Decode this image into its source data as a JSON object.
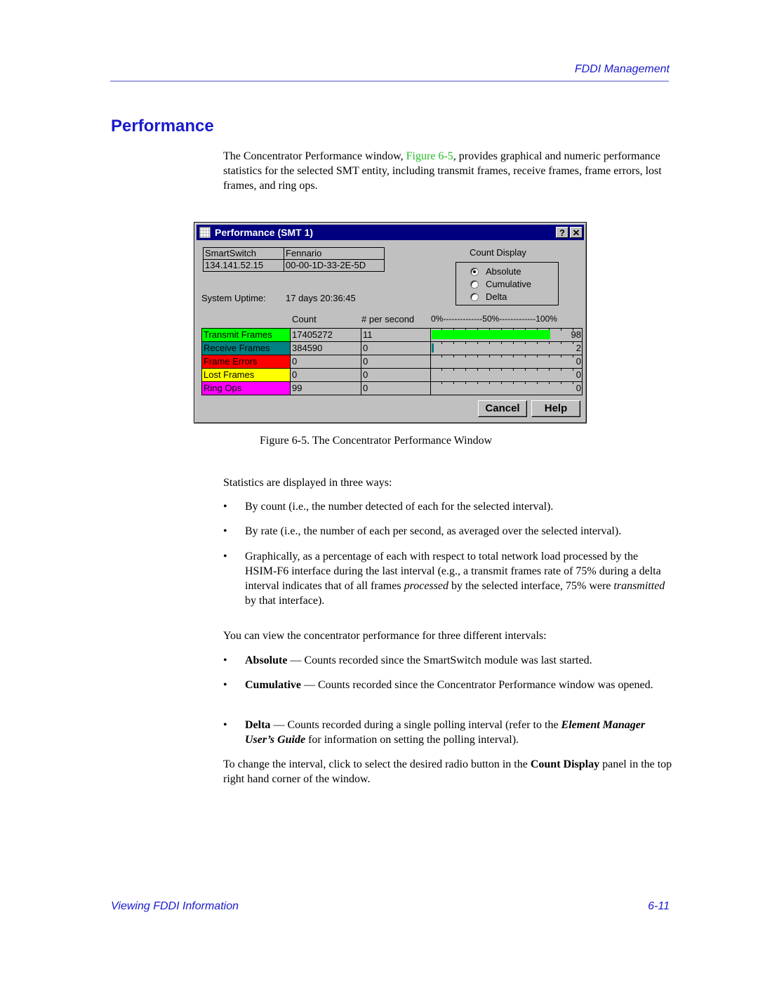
{
  "header": {
    "running_head": "FDDI Management"
  },
  "section": {
    "title": "Performance",
    "intro_pre": "The Concentrator Performance window, ",
    "intro_xref": "Figure 6-5",
    "intro_post": ", provides graphical and numeric performance statistics for the selected SMT entity, including transmit frames, receive frames, frame errors, lost frames, and ring ops."
  },
  "dialog": {
    "title": "Performance (SMT 1)",
    "help_btn": "?",
    "close_btn": "✕",
    "info": [
      [
        "SmartSwitch",
        "Fennario"
      ],
      [
        "134.141.52.15",
        "00-00-1D-33-2E-5D"
      ]
    ],
    "uptime_label": "System Uptime:",
    "uptime_value": "17 days 20:36:45",
    "count_display_label": "Count Display",
    "radios": [
      {
        "label": "Absolute",
        "selected": true
      },
      {
        "label": "Cumulative",
        "selected": false
      },
      {
        "label": "Delta",
        "selected": false
      }
    ],
    "columns": {
      "count": "Count",
      "rate": "# per second",
      "scale": "0%--------------50%-------------100%"
    },
    "rows": [
      {
        "name": "Transmit Frames",
        "count": "17405272",
        "rate": "11",
        "percent": 98,
        "color": "#00ff00"
      },
      {
        "name": "Receive Frames",
        "count": "384590",
        "rate": "0",
        "percent": 2,
        "color": "#008080"
      },
      {
        "name": "Frame Errors",
        "count": "0",
        "rate": "0",
        "percent": 0,
        "color": "#ff0000"
      },
      {
        "name": "Lost Frames",
        "count": "0",
        "rate": "0",
        "percent": 0,
        "color": "#ffff00"
      },
      {
        "name": "Ring Ops",
        "count": "99",
        "rate": "0",
        "percent": 0,
        "color": "#ff00ff"
      }
    ],
    "cancel": "Cancel",
    "help": "Help"
  },
  "caption": "Figure 6-5.  The Concentrator Performance Window",
  "stats_intro": "Statistics are displayed in three ways:",
  "ways": [
    "By count (i.e., the number detected of each for the selected interval).",
    "By rate (i.e., the number of each per second, as averaged over the selected interval)."
  ],
  "graph_bullet": {
    "a": "Graphically, as a percentage of each with respect to total network load processed by the HSIM-F6 interface during the last interval (e.g., a transmit frames rate of 75% during a delta interval indicates that of all frames ",
    "em1": "processed",
    "b": " by the selected interface, 75% were ",
    "em2": "transmitted",
    "c": " by that interface)."
  },
  "intervals_intro": "You can view the concentrator performance for three different intervals:",
  "intervals": [
    {
      "term": "Absolute",
      "desc": " — Counts recorded since the SmartSwitch module was last started."
    },
    {
      "term": "Cumulative",
      "desc": " — Counts recorded since the Concentrator Performance window was opened."
    }
  ],
  "delta": {
    "term": "Delta",
    "a": " — Counts recorded during a single polling interval (refer to the ",
    "guide": "Element Manager User’s Guide",
    "b": " for information on setting the polling interval)."
  },
  "change": {
    "a": "To change the interval, click to select the desired radio button in the ",
    "bold": "Count Display",
    "b": " panel in the top right hand corner of the window."
  },
  "footer": {
    "left": "Viewing FDDI Information",
    "right": "6-11"
  }
}
